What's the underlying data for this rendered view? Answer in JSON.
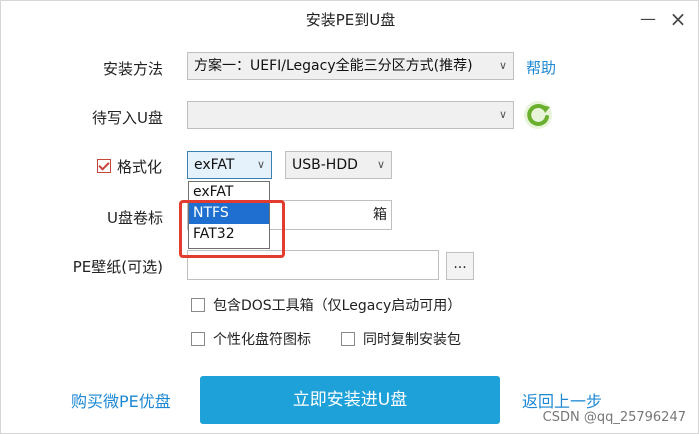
{
  "window": {
    "title": "安装PE到U盘",
    "minimize_symbol": "—",
    "close_symbol": "×"
  },
  "install_method": {
    "label": "安装方法",
    "value": "方案一：UEFI/Legacy全能三分区方式(推荐)",
    "help_link": "帮助"
  },
  "target_drive": {
    "label": "待写入U盘",
    "value": ""
  },
  "format": {
    "label": "格式化",
    "checked": true,
    "filesystem_value": "exFAT",
    "filesystem_options": [
      "exFAT",
      "NTFS",
      "FAT32"
    ],
    "highlighted_option": "NTFS",
    "mode_value": "USB-HDD"
  },
  "volume_label": {
    "label": "U盘卷标",
    "value": "箱"
  },
  "wallpaper": {
    "label": "PE壁纸(可选)",
    "value": "",
    "browse_label": "..."
  },
  "options": {
    "dos_toolbox": "包含DOS工具箱（仅Legacy启动可用）",
    "custom_icon": "个性化盘符图标",
    "copy_package": "同时复制安装包"
  },
  "footer": {
    "buy_link": "购买微PE优盘",
    "install_button": "立即安装进U盘",
    "back_link": "返回上一步"
  },
  "watermark": "CSDN @qq_25796247",
  "colors": {
    "accent": "#1ea0d8",
    "link": "#1e88d3",
    "selection": "#1e6fd0",
    "annotation_red": "#e23b2f",
    "refresh_green": "#6ab02e"
  }
}
